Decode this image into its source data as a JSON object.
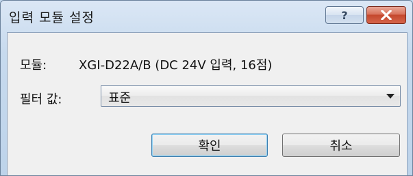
{
  "window": {
    "title": "입력 모듈 설정",
    "help_label": "?"
  },
  "module": {
    "label": "모듈:",
    "value": "XGI-D22A/B (DC 24V 입력, 16점)"
  },
  "filter": {
    "label": "필터 값:",
    "selected": "표준"
  },
  "buttons": {
    "ok": "확인",
    "cancel": "취소"
  },
  "colors": {
    "close_button": "#c4482d",
    "ok_border": "#3c7fb1"
  }
}
